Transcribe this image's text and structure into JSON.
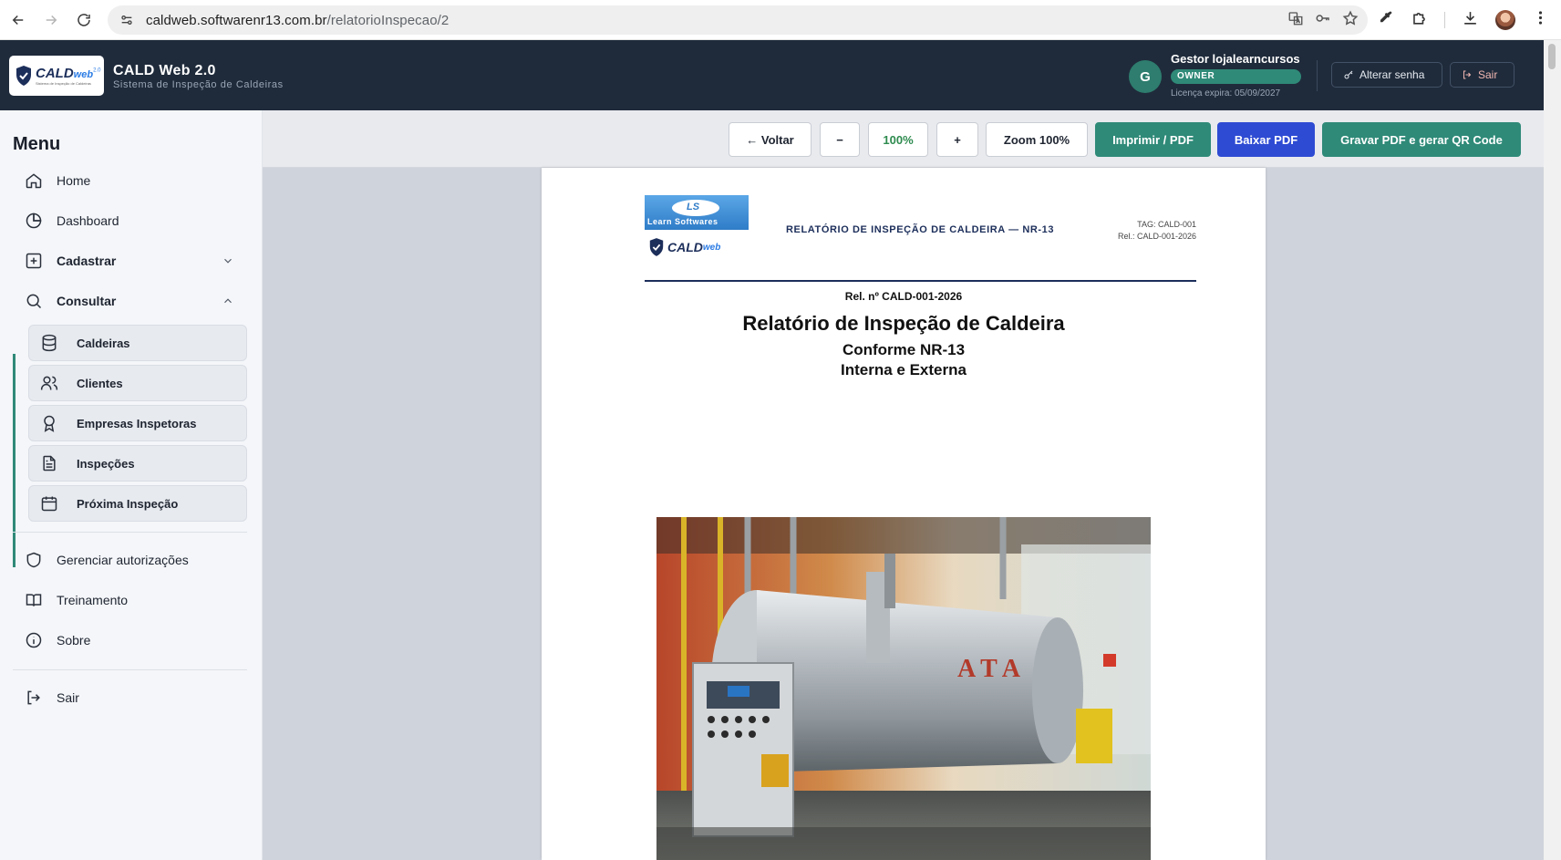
{
  "browser": {
    "url_host": "caldweb.softwarenr13.com.br",
    "url_path": "/relatorioInspecao/2"
  },
  "header": {
    "logo_text": "CALD web",
    "logo_version": "2.0",
    "logo_subtext": "Sistema de Inspeção de Caldeiras",
    "app_title": "CALD Web 2.0",
    "app_subtitle": "Sistema de Inspeção de Caldeiras",
    "user_initial": "G",
    "user_name": "Gestor lojalearncursos",
    "user_role": "OWNER",
    "license": "Licença expira: 05/09/2027",
    "change_password_label": "Alterar senha",
    "logout_label": "Sair"
  },
  "sidebar": {
    "title": "Menu",
    "items": [
      {
        "label": "Home",
        "icon": "home-icon"
      },
      {
        "label": "Dashboard",
        "icon": "pie-chart-icon"
      },
      {
        "label": "Cadastrar",
        "icon": "plus-square-icon"
      },
      {
        "label": "Consultar",
        "icon": "search-icon"
      }
    ],
    "submenu": [
      {
        "label": "Caldeiras",
        "icon": "database-icon"
      },
      {
        "label": "Clientes",
        "icon": "users-icon"
      },
      {
        "label": "Empresas Inspetoras",
        "icon": "award-icon"
      },
      {
        "label": "Inspeções",
        "icon": "file-text-icon"
      },
      {
        "label": "Próxima Inspeção",
        "icon": "calendar-icon"
      }
    ],
    "bottom": [
      {
        "label": "Gerenciar autorizações",
        "icon": "shield-icon"
      },
      {
        "label": "Treinamento",
        "icon": "book-icon"
      },
      {
        "label": "Sobre",
        "icon": "info-icon"
      }
    ],
    "logout": {
      "label": "Sair",
      "icon": "logout-icon"
    }
  },
  "toolbar": {
    "back_label": "← Voltar",
    "zoom_out_label": "−",
    "zoom_value": "100%",
    "zoom_in_label": "+",
    "zoom_reset_label": "Zoom 100%",
    "print_label": "Imprimir / PDF",
    "download_label": "Baixar PDF",
    "save_qr_label": "Gravar PDF e gerar QR Code"
  },
  "document": {
    "ls_logo_mark": "LS",
    "ls_logo_text": "Learn Softwares",
    "cald_logo_text": "CALD",
    "cald_logo_web": "web",
    "header_title": "RELATÓRIO DE INSPEÇÃO DE CALDEIRA — NR-13",
    "tag": "TAG: CALD-001",
    "rel": "Rel.: CALD-001-2026",
    "rel_number": "Rel. nº CALD-001-2026",
    "title": "Relatório de Inspeção de Caldeira",
    "subtitle1": "Conforme NR-13",
    "subtitle2": "Interna e Externa"
  },
  "colors": {
    "header_bg": "#1f2b3b",
    "accent_green": "#2f8a78",
    "accent_blue": "#2e4bd3"
  }
}
